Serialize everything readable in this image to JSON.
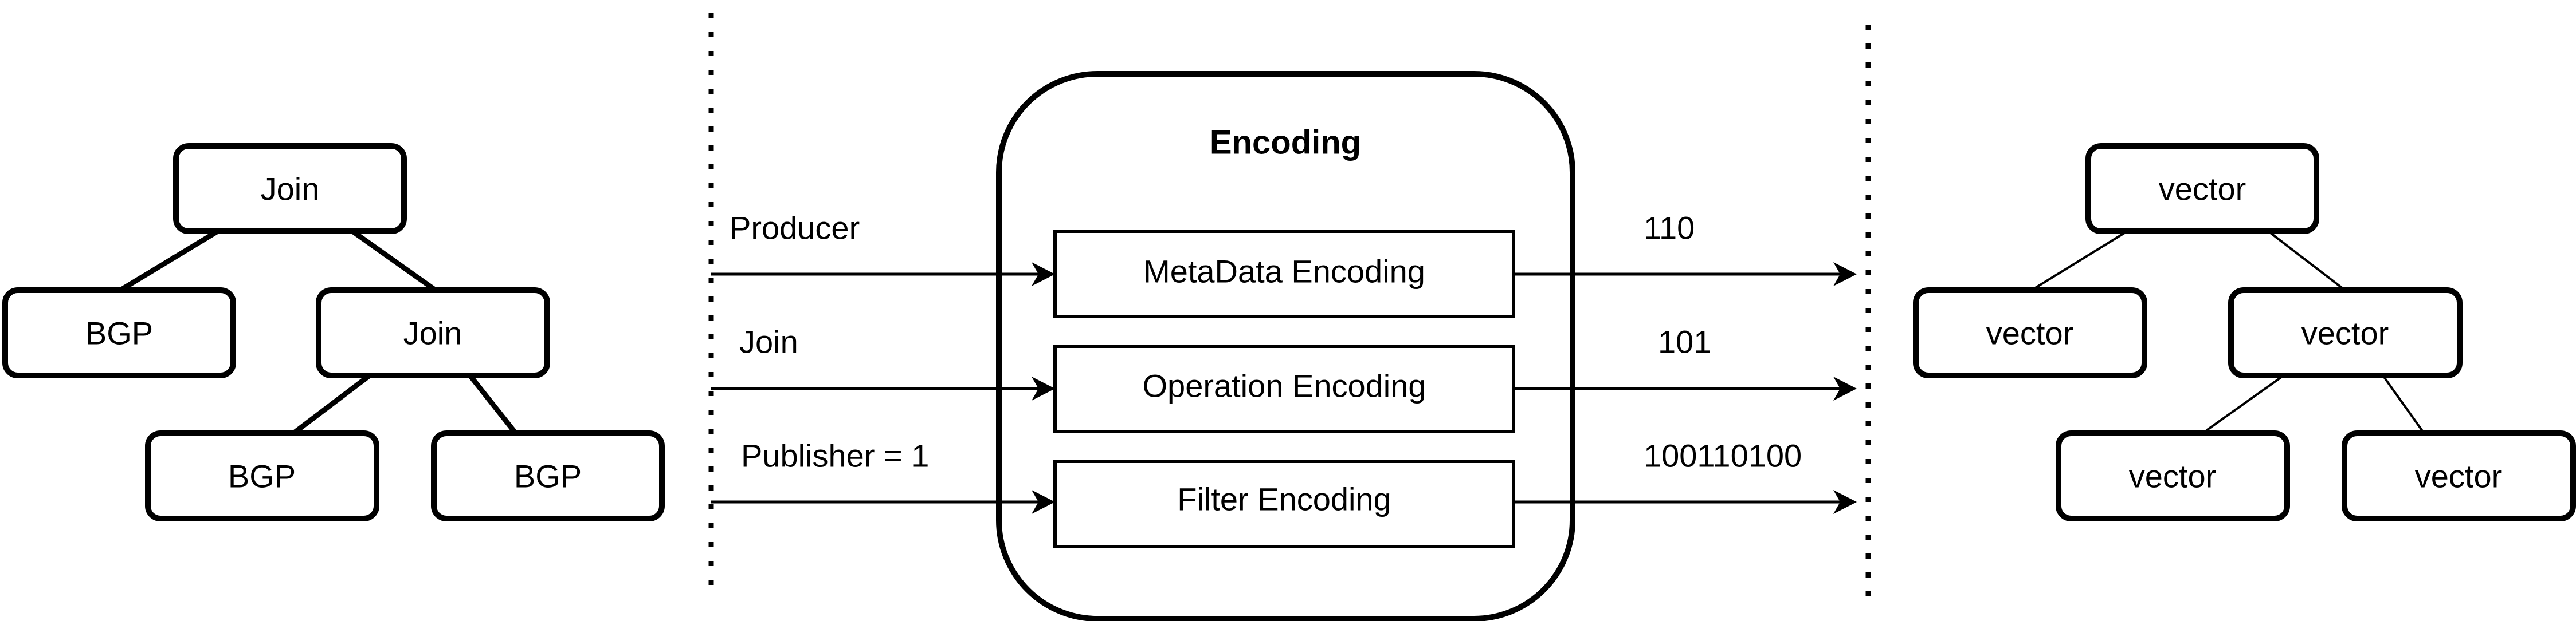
{
  "left_tree": {
    "nodes": [
      {
        "id": "root",
        "label": "Join"
      },
      {
        "id": "left",
        "label": "BGP"
      },
      {
        "id": "mid",
        "label": "Join"
      },
      {
        "id": "bl",
        "label": "BGP"
      },
      {
        "id": "br",
        "label": "BGP"
      }
    ],
    "edges": [
      [
        "root",
        "left"
      ],
      [
        "root",
        "mid"
      ],
      [
        "mid",
        "bl"
      ],
      [
        "mid",
        "br"
      ]
    ]
  },
  "encoding": {
    "title": "Encoding",
    "modules": [
      {
        "label": "MetaData Encoding",
        "input": "Producer",
        "output": "110"
      },
      {
        "label": "Operation Encoding",
        "input": "Join",
        "output": "101"
      },
      {
        "label": "Filter Encoding",
        "input": "Publisher = 1",
        "output": "100110100"
      }
    ]
  },
  "right_tree": {
    "nodes": [
      {
        "id": "root",
        "label": "vector"
      },
      {
        "id": "left",
        "label": "vector"
      },
      {
        "id": "mid",
        "label": "vector"
      },
      {
        "id": "bl",
        "label": "vector"
      },
      {
        "id": "br",
        "label": "vector"
      }
    ],
    "edges": [
      [
        "root",
        "left"
      ],
      [
        "root",
        "mid"
      ],
      [
        "mid",
        "bl"
      ],
      [
        "mid",
        "br"
      ]
    ]
  },
  "colors": {
    "stroke": "#000000",
    "background": "#ffffff"
  }
}
